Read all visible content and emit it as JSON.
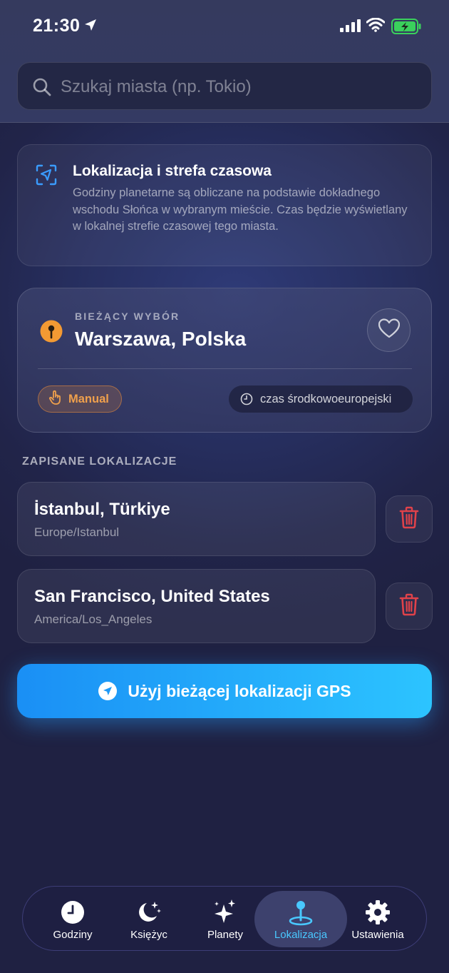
{
  "status_bar": {
    "time": "21:30",
    "icons": [
      "location-arrow-icon",
      "signal-icon",
      "wifi-icon",
      "battery-charging-icon"
    ]
  },
  "search": {
    "placeholder": "Szukaj miasta (np. Tokio)",
    "value": ""
  },
  "info_card": {
    "icon": "location-scan-icon",
    "title": "Lokalizacja i strefa czasowa",
    "description": "Godziny planetarne są obliczane na podstawie dokładnego wschodu Słońca w wybranym mieście. Czas będzie wyświetlany w lokalnej strefie czasowej tego miasta."
  },
  "current_selection": {
    "label": "BIEŻĄCY WYBÓR",
    "city": "Warszawa, Polska",
    "source_badge": "Manual",
    "timezone": "czas środkowoeuropejski",
    "favorite": false
  },
  "saved": {
    "title": "ZAPISANE LOKALIZACJE",
    "items": [
      {
        "name": "İstanbul, Türkiye",
        "timezone": "Europe/Istanbul"
      },
      {
        "name": "San Francisco, United States",
        "timezone": "America/Los_Angeles"
      }
    ]
  },
  "gps_button": {
    "label": "Użyj bieżącej lokalizacji GPS"
  },
  "tabbar": {
    "active": "Lokalizacja",
    "tabs": [
      {
        "label": "Godziny",
        "icon": "clock-icon"
      },
      {
        "label": "Księżyc",
        "icon": "moon-stars-icon"
      },
      {
        "label": "Planety",
        "icon": "sparkles-icon"
      },
      {
        "label": "Lokalizacja",
        "icon": "location-pin-icon"
      },
      {
        "label": "Ustawienia",
        "icon": "gear-icon"
      }
    ]
  },
  "colors": {
    "accent_blue": "#2cc4ff",
    "manual_orange": "#f0a04c",
    "delete_red": "#e0424a"
  }
}
